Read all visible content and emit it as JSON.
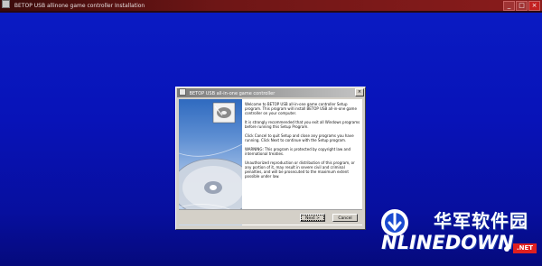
{
  "window": {
    "title": "BETOP USB allinone game controller Installation",
    "controls": {
      "minimize": "_",
      "maximize": "□",
      "close": "×"
    }
  },
  "dialog": {
    "title": "BETOP USB all-in-one game controller",
    "close_label": "×",
    "paragraphs": [
      "Welcome to BETOP USB all-in-one game controller Setup program. This program will install BETOP USB all-in-one game controller on your computer.",
      "It is strongly recommended that you exit all Windows programs before running this Setup Program.",
      "Click Cancel to quit Setup and close any programs you have running. Click Next to continue with the Setup program.",
      "WARNING: This program is protected by copyright law and international treaties.",
      "Unauthorized reproduction or distribution of this program, or any portion of it, may result in severe civil and criminal penalties, and will be prosecuted to the maximum extent possible under law."
    ],
    "buttons": {
      "next": "Next >",
      "cancel": "Cancel"
    }
  },
  "watermark": {
    "cn": "华军软件园",
    "en": "NLINEDOWN",
    "net": ".NET"
  },
  "colors": {
    "background": "#0813b8",
    "titlebar": "#6e1616",
    "watermark_red": "#e02020"
  }
}
